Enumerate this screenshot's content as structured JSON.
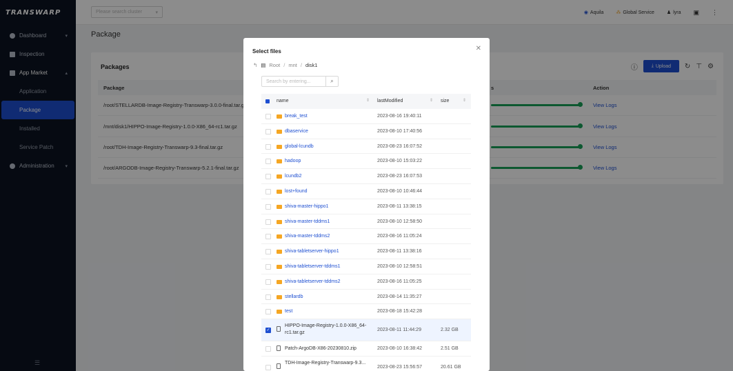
{
  "brand": "TRANSWARP",
  "sidebar": {
    "items": [
      {
        "label": "Dashboard",
        "icon": "dashboard-icon"
      },
      {
        "label": "Inspection",
        "icon": "inspection-icon"
      },
      {
        "label": "App Market",
        "icon": "app-market-icon"
      },
      {
        "label": "Application"
      },
      {
        "label": "Package"
      },
      {
        "label": "Installed"
      },
      {
        "label": "Service Patch"
      },
      {
        "label": "Administration",
        "icon": "administration-icon"
      }
    ],
    "footer_icon": "menu-icon"
  },
  "topbar": {
    "cluster_placeholder": "Please search cluster",
    "user_items": [
      "Aquila",
      "Global Service",
      "lyra"
    ]
  },
  "page": {
    "title": "Package",
    "card_title": "Packages",
    "upload_label": "Upload",
    "table": {
      "headers": [
        "Package",
        "s",
        "Action"
      ],
      "rows": [
        {
          "package": "/root/STELLARDB-Image-Registry-Transwarp-3.0.0-final.tar.gz",
          "action": "View Logs"
        },
        {
          "package": "/mnt/disk1/HIPPO-Image-Registry-1.0.0-X86_64-rc1.tar.gz",
          "action": "View Logs"
        },
        {
          "package": "/root/TDH-Image-Registry-Transwarp-9.3-final.tar.gz",
          "action": "View Logs"
        },
        {
          "package": "/root/ARGODB-Image-Registry-Transwarp-5.2.1-final.tar.gz",
          "action": "View Logs"
        }
      ]
    }
  },
  "modal": {
    "title": "Select files",
    "breadcrumb": [
      "Root",
      "mnt",
      "disk1"
    ],
    "search_placeholder": "Search by entering...",
    "columns": [
      "name",
      "lastModified",
      "size"
    ],
    "files": [
      {
        "name": "break_test",
        "modified": "2023-08-16 19:40:11",
        "size": "",
        "type": "folder"
      },
      {
        "name": "dbaservice",
        "modified": "2023-08-10 17:40:56",
        "size": "",
        "type": "folder"
      },
      {
        "name": "global-lcundb",
        "modified": "2023-08-23 16:07:52",
        "size": "",
        "type": "folder"
      },
      {
        "name": "hadoop",
        "modified": "2023-08-10 15:03:22",
        "size": "",
        "type": "folder"
      },
      {
        "name": "lcundb2",
        "modified": "2023-08-23 16:07:53",
        "size": "",
        "type": "folder"
      },
      {
        "name": "lost+found",
        "modified": "2023-08-10 10:46:44",
        "size": "",
        "type": "folder"
      },
      {
        "name": "shiva-master-hippo1",
        "modified": "2023-08-11 13:38:15",
        "size": "",
        "type": "folder"
      },
      {
        "name": "shiva-master-tddms1",
        "modified": "2023-08-10 12:58:50",
        "size": "",
        "type": "folder"
      },
      {
        "name": "shiva-master-tddms2",
        "modified": "2023-08-16 11:05:24",
        "size": "",
        "type": "folder"
      },
      {
        "name": "shiva-tabletserver-hippo1",
        "modified": "2023-08-11 13:38:16",
        "size": "",
        "type": "folder"
      },
      {
        "name": "shiva-tabletserver-tddms1",
        "modified": "2023-08-10 12:58:51",
        "size": "",
        "type": "folder"
      },
      {
        "name": "shiva-tabletserver-tddms2",
        "modified": "2023-08-16 11:05:25",
        "size": "",
        "type": "folder"
      },
      {
        "name": "stellardb",
        "modified": "2023-08-14 11:35:27",
        "size": "",
        "type": "folder"
      },
      {
        "name": "test",
        "modified": "2023-08-18 15:42:28",
        "size": "",
        "type": "folder"
      },
      {
        "name": "HIPPO-Image-Registry-1.0.0-X86_64-rc1.tar.gz",
        "modified": "2023-08-11 11:44:29",
        "size": "2.32 GB",
        "type": "file",
        "checked": true
      },
      {
        "name": "Patch-ArgoDB-X86-20230810.zip",
        "modified": "2023-08-10 16:38:42",
        "size": "2.51 GB",
        "type": "file"
      },
      {
        "name": "TDH-Image-Registry-Transwarp-9.3...",
        "modified": "2023-08-23 15:56:57",
        "size": "20.61 GB",
        "type": "file"
      }
    ]
  }
}
